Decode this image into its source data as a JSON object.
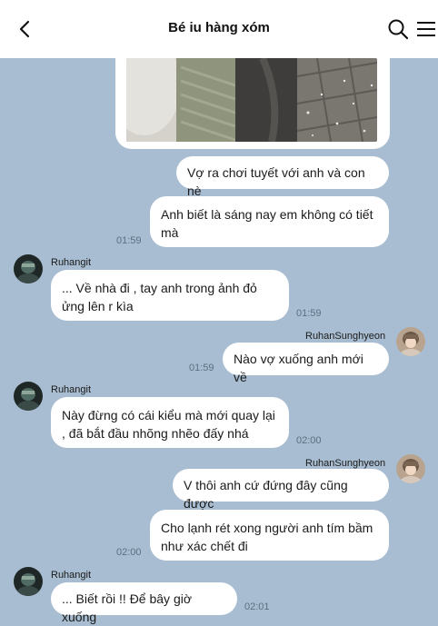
{
  "header": {
    "title": "Bé iu hàng xóm",
    "back_icon": "chevron-left-icon",
    "search_icon": "search-icon",
    "menu_icon": "menu-icon"
  },
  "messages": [
    {
      "text": "Vợ ra chơi tuyết với anh và con nè"
    },
    {
      "text": "Anh biết là sáng nay em không có tiết mà",
      "time": "01:59"
    },
    {
      "sender": "Ruhangit",
      "text": "... Về nhà đi , tay anh trong ảnh đỏ ửng lên r kìa",
      "time": "01:59"
    },
    {
      "sender": "RuhanSunghyeon",
      "text": "Nào vợ xuống anh mới về",
      "time": "01:59"
    },
    {
      "sender": "Ruhangit",
      "text": "Này đừng có cái kiểu mà mới quay lại , đã bắt đầu nhõng nhẽo đấy nhá",
      "time": "02:00"
    },
    {
      "sender": "RuhanSunghyeon",
      "text": "V thôi anh cứ đứng đây cũng được"
    },
    {
      "text": "Cho lạnh rét xong người anh tím bầm như xác chết đi",
      "time": "02:00"
    },
    {
      "sender": "Ruhangit",
      "text": "... Biết rồi !! Để bây giờ xuống",
      "time": "02:01"
    }
  ]
}
